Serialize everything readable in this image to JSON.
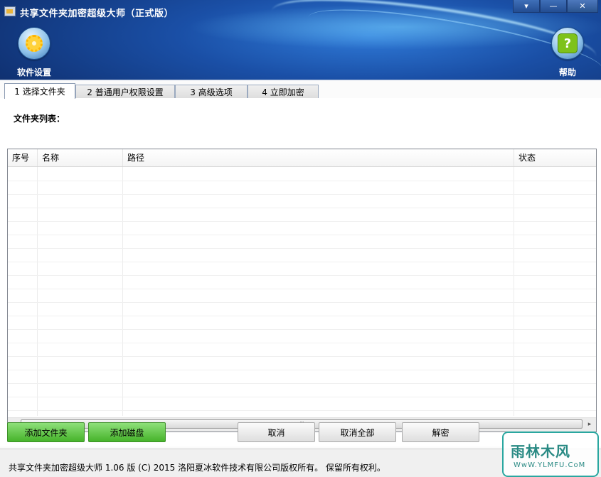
{
  "window": {
    "title": "共享文件夹加密超级大师（正式版）",
    "controls": [
      "▾",
      "—",
      "✕"
    ]
  },
  "toolbar": {
    "settings_label": "软件设置",
    "help_label": "帮助",
    "help_glyph": "?"
  },
  "tabs": [
    {
      "label": "1 选择文件夹",
      "active": true
    },
    {
      "label": "2 普通用户权限设置",
      "active": false
    },
    {
      "label": "3 高级选项",
      "active": false
    },
    {
      "label": "4 立即加密",
      "active": false
    }
  ],
  "folder_list": {
    "label": "文件夹列表：",
    "columns": [
      "序号",
      "名称",
      "路径",
      "状态"
    ]
  },
  "scrollbar": {
    "left_arrow": "◂",
    "right_arrow": "▸",
    "grip": "|||"
  },
  "buttons": {
    "add_folder": "添加文件夹",
    "add_disk": "添加磁盘",
    "cancel": "取消",
    "cancel_all": "取消全部",
    "decrypt": "解密"
  },
  "status": {
    "text": "共享文件夹加密超级大师 1.06 版  (C)  2015 洛阳夏冰软件技术有限公司版权所有。 保留所有权利。"
  },
  "watermark": {
    "title": "雨林木风",
    "url": "WwW.YLMFU.CoM"
  },
  "colors": {
    "header_blue": "#1a4fa6",
    "button_green": "#46b32a",
    "watermark_teal": "#2a8a84"
  }
}
